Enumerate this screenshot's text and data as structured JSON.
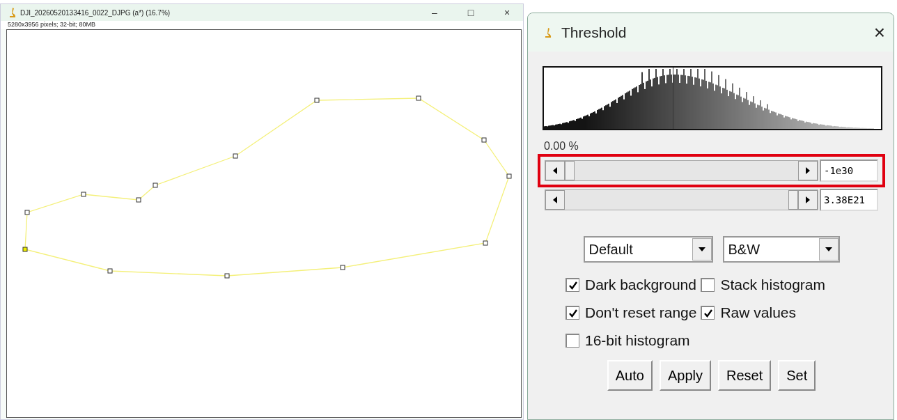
{
  "image_window": {
    "title": "DJI_20260520133416_0022_DJPG (a*) (16.7%)",
    "info": "5280x3956 pixels; 32-bit; 80MB",
    "controls": [
      "–",
      "□",
      "×"
    ]
  },
  "threshold_window": {
    "title": "Threshold",
    "close": "×",
    "percent": "0.00 %",
    "sliders": [
      {
        "level": 0.0,
        "value": "-1e30",
        "highlighted": true
      },
      {
        "level": 1.0,
        "value": "3.38E21",
        "highlighted": false
      }
    ],
    "dropdowns": [
      {
        "value": "Default"
      },
      {
        "value": "B&W"
      }
    ],
    "checkboxes": [
      {
        "label": "Dark background",
        "checked": true
      },
      {
        "label": "Stack histogram",
        "checked": false
      },
      {
        "label": "Don't reset range",
        "checked": true
      },
      {
        "label": "Raw values",
        "checked": true
      },
      {
        "label": "16-bit histogram",
        "checked": false
      }
    ],
    "buttons": [
      "Auto",
      "Apply",
      "Reset",
      "Set"
    ]
  }
}
